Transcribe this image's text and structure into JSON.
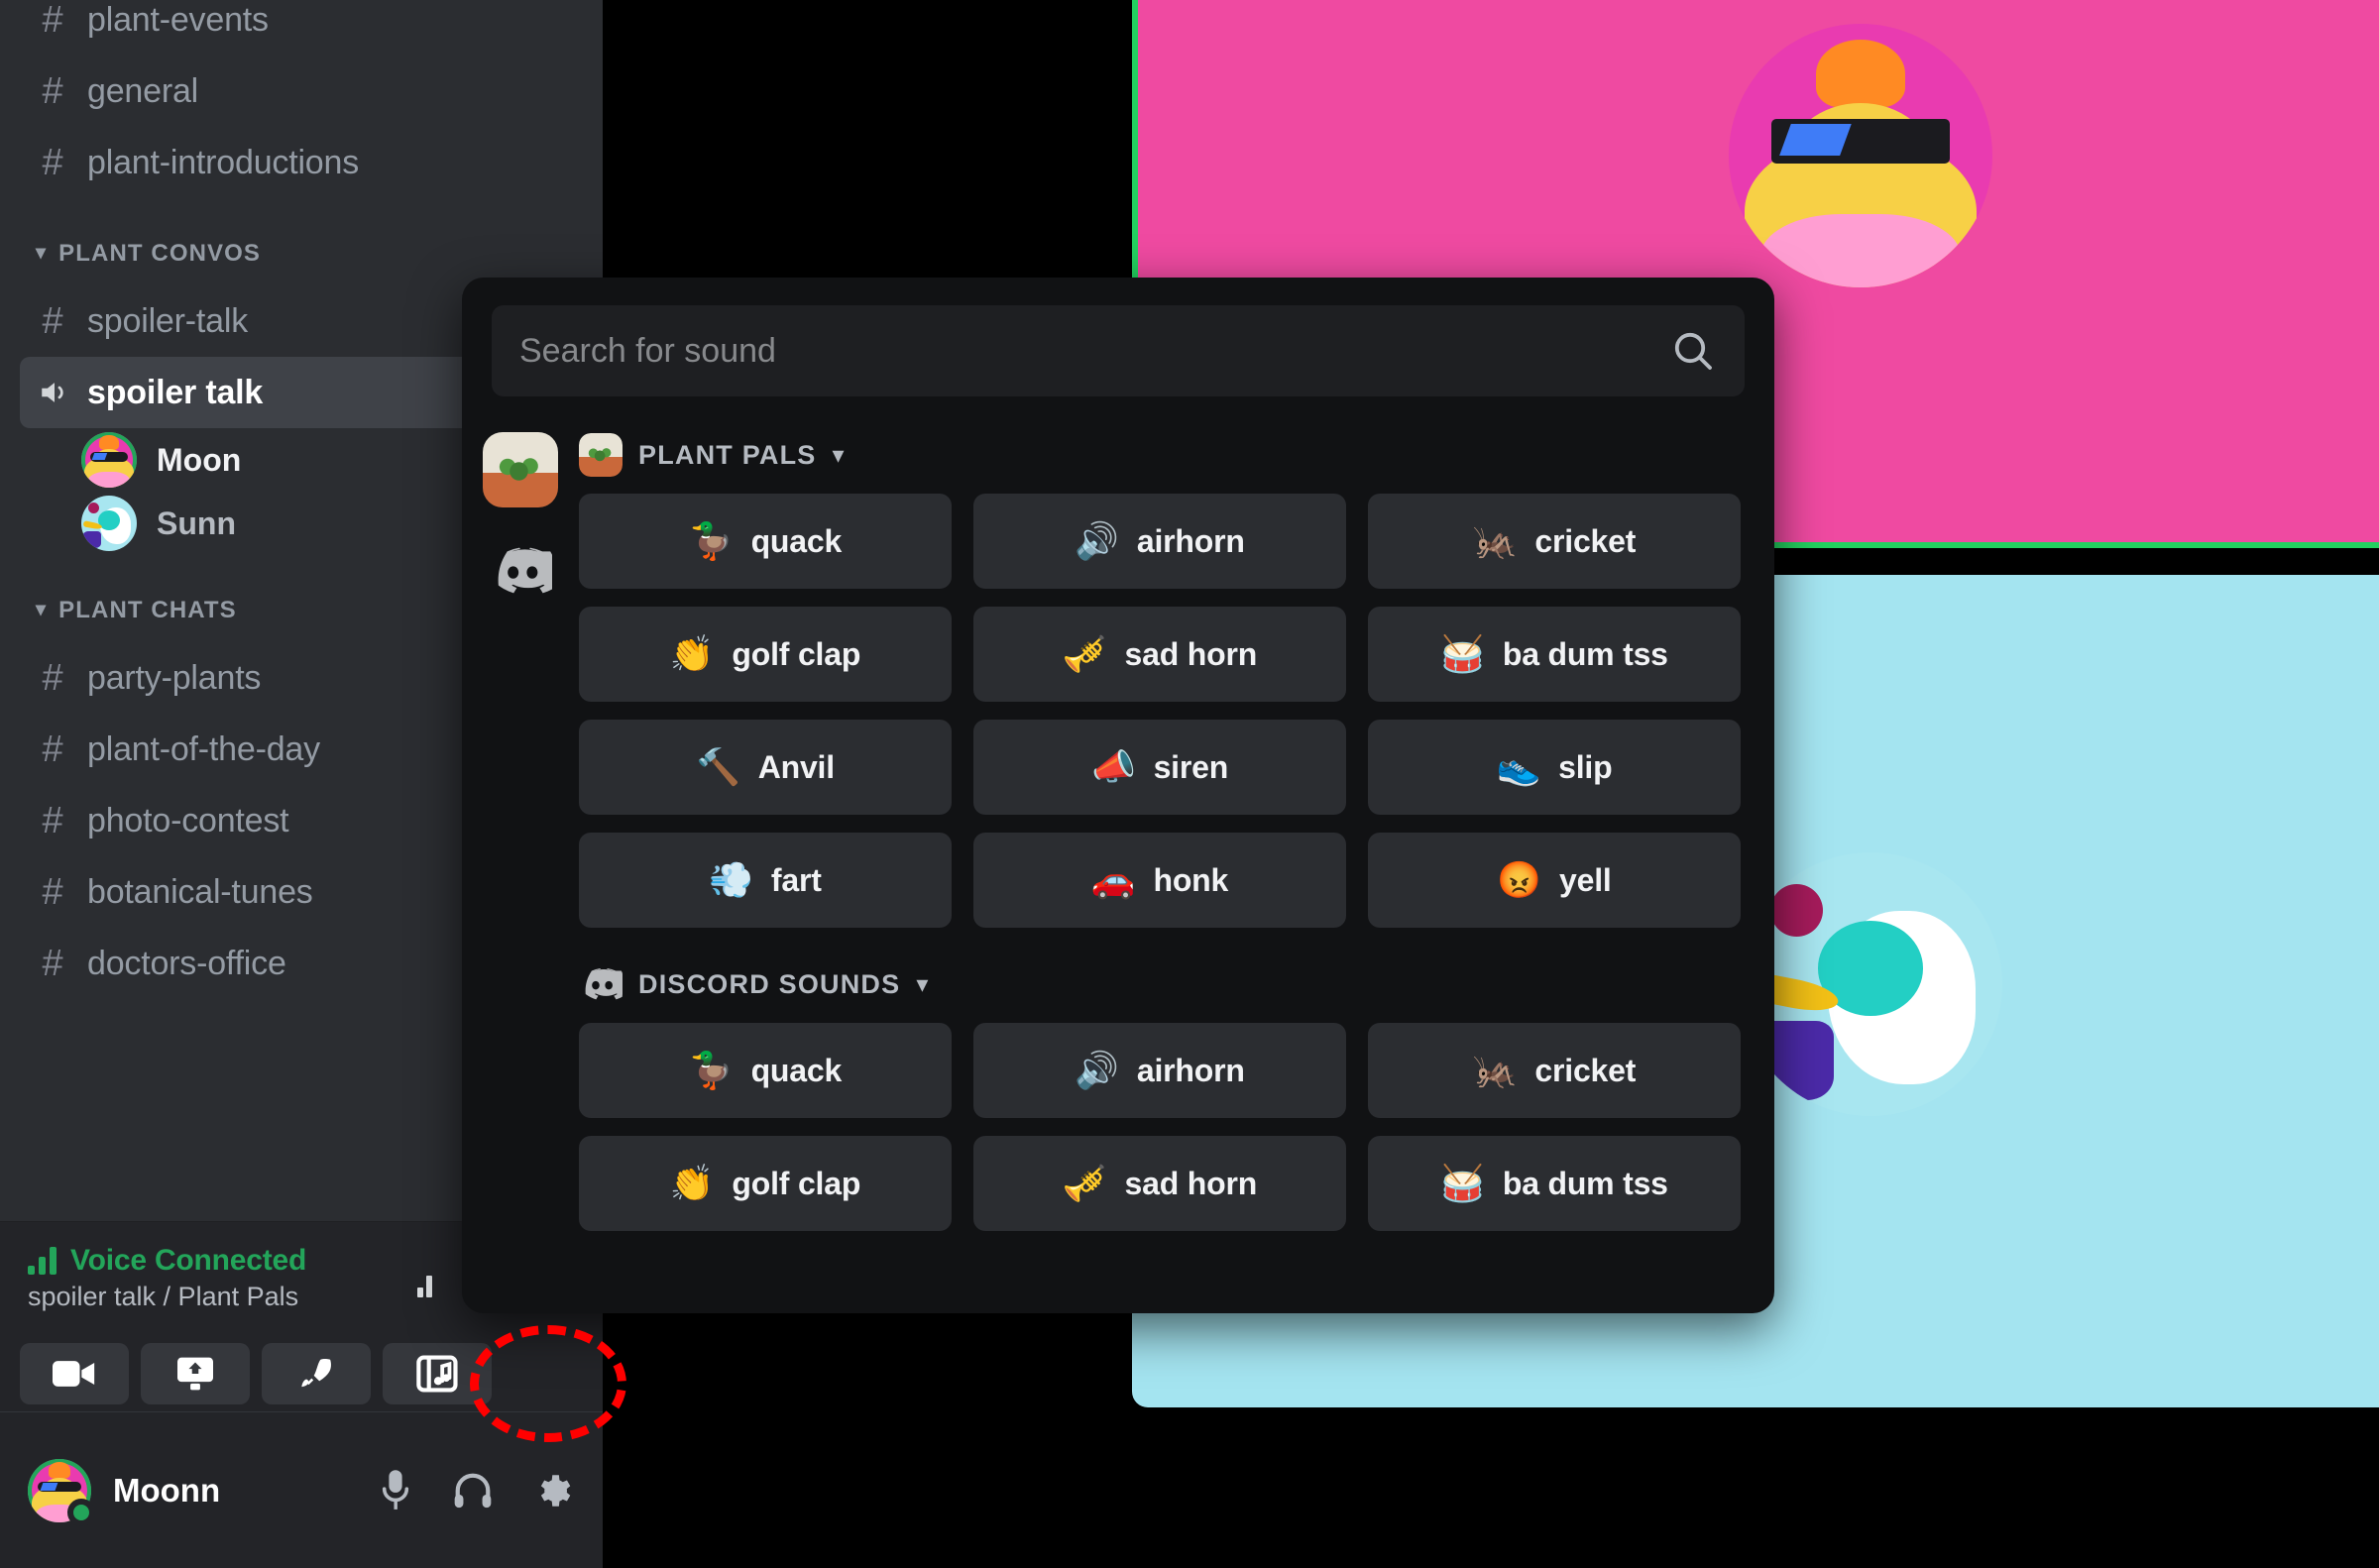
{
  "sidebar": {
    "top_channels": [
      {
        "icon": "hash-icon",
        "label": "plant-events"
      },
      {
        "icon": "hash-icon",
        "label": "general"
      },
      {
        "icon": "hash-icon",
        "label": "plant-introductions"
      }
    ],
    "categories": [
      {
        "label": "PLANT CONVOS",
        "channels": [
          {
            "icon": "hash-icon",
            "label": "spoiler-talk",
            "selected": false
          },
          {
            "icon": "speaker-icon",
            "label": "spoiler talk",
            "selected": true
          }
        ],
        "members": [
          {
            "name": "Moon",
            "speaking": true
          },
          {
            "name": "Sunn",
            "speaking": false
          }
        ]
      },
      {
        "label": "PLANT CHATS",
        "channels": [
          {
            "icon": "hash-icon",
            "label": "party-plants",
            "selected": false
          },
          {
            "icon": "hash-icon",
            "label": "plant-of-the-day",
            "selected": false
          },
          {
            "icon": "hash-icon",
            "label": "photo-contest",
            "selected": false
          },
          {
            "icon": "hash-icon",
            "label": "botanical-tunes",
            "selected": false
          },
          {
            "icon": "hash-icon",
            "label": "doctors-office",
            "selected": false
          }
        ],
        "members": []
      }
    ],
    "voice": {
      "status": "Voice Connected",
      "location": "spoiler talk / Plant Pals",
      "status_color": "#23a55a",
      "actions": [
        {
          "name": "video-camera-button",
          "icon": "video-camera-icon"
        },
        {
          "name": "screen-share-button",
          "icon": "screen-share-icon"
        },
        {
          "name": "activities-button",
          "icon": "rocket-icon"
        },
        {
          "name": "soundboard-button",
          "icon": "soundboard-icon",
          "highlighted": true
        }
      ]
    },
    "user": {
      "name": "Moonn",
      "status": "online",
      "controls": [
        {
          "name": "mute-button",
          "icon": "microphone-icon"
        },
        {
          "name": "deafen-button",
          "icon": "headphones-icon"
        },
        {
          "name": "user-settings-button",
          "icon": "gear-icon"
        }
      ]
    }
  },
  "stage": {
    "tiles": [
      {
        "name": "video-tile-moon",
        "color": "#ef4aa1",
        "speaking": true,
        "border_color": "#23d160"
      },
      {
        "name": "video-tile-sunn",
        "color": "#a4e4f0",
        "speaking": false,
        "border_color": ""
      }
    ]
  },
  "soundboard": {
    "search": {
      "placeholder": "Search for sound",
      "value": ""
    },
    "settings_icon": "gear-icon",
    "search_icon": "search-icon",
    "rail": [
      {
        "name": "server-plant-pals",
        "icon": "plant-server-avatar"
      },
      {
        "name": "discord-default-sounds",
        "icon": "discord-logo-icon"
      }
    ],
    "sections": [
      {
        "title": "PLANT PALS",
        "icon": "plant-server-avatar",
        "chevron": "chevron-down-icon",
        "sounds": [
          {
            "emoji": "🦆",
            "label": "quack"
          },
          {
            "emoji": "🔊",
            "label": "airhorn"
          },
          {
            "emoji": "🦗",
            "label": "cricket"
          },
          {
            "emoji": "👏",
            "label": "golf clap"
          },
          {
            "emoji": "🎺",
            "label": "sad horn"
          },
          {
            "emoji": "🥁",
            "label": "ba dum tss"
          },
          {
            "emoji": "🔨",
            "label": "Anvil"
          },
          {
            "emoji": "📣",
            "label": "siren"
          },
          {
            "emoji": "👟",
            "label": "slip"
          },
          {
            "emoji": "💨",
            "label": "fart"
          },
          {
            "emoji": "🚗",
            "label": "honk"
          },
          {
            "emoji": "😡",
            "label": "yell"
          }
        ]
      },
      {
        "title": "DISCORD SOUNDS",
        "icon": "discord-logo-icon",
        "chevron": "chevron-down-icon",
        "sounds": [
          {
            "emoji": "🦆",
            "label": "quack"
          },
          {
            "emoji": "🔊",
            "label": "airhorn"
          },
          {
            "emoji": "🦗",
            "label": "cricket"
          },
          {
            "emoji": "👏",
            "label": "golf clap"
          },
          {
            "emoji": "🎺",
            "label": "sad horn"
          },
          {
            "emoji": "🥁",
            "label": "ba dum tss"
          }
        ]
      }
    ]
  },
  "annotation": {
    "name": "soundboard-button-highlight",
    "color": "#ff0000"
  }
}
